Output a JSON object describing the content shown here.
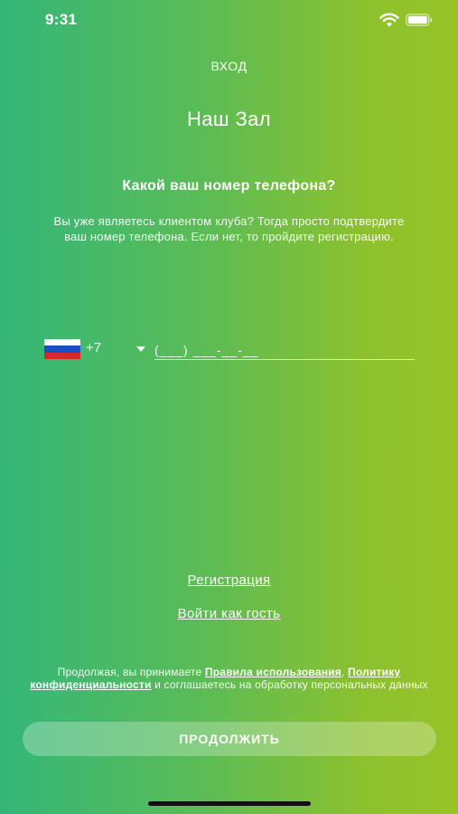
{
  "status_bar": {
    "time": "9:31",
    "wifi_icon": "wifi-icon",
    "battery_icon": "battery-icon"
  },
  "header": {
    "screen_label": "ВХОД",
    "app_title": "Наш Зал"
  },
  "content": {
    "question": "Какой ваш номер телефона?",
    "subtitle": "Вы уже являетесь клиентом клуба? Тогда просто подтвердите ваш номер телефона. Если нет, то пройдите регистрацию."
  },
  "phone_input": {
    "country_flag": "russia-flag",
    "dial_code": "+7",
    "placeholder": "(___) ___-__-__",
    "value": ""
  },
  "links": {
    "register": "Регистрация",
    "guest": "Войти как гость"
  },
  "terms": {
    "prefix": "Продолжая, вы принимаете ",
    "rules_link": "Правила использования",
    "comma": ",",
    "privacy_link": "Политику конфиденциальности",
    "suffix": " и соглашаетесь на обработку персональных данных"
  },
  "continue_button": {
    "label": "ПРОДОЛЖИТЬ"
  }
}
